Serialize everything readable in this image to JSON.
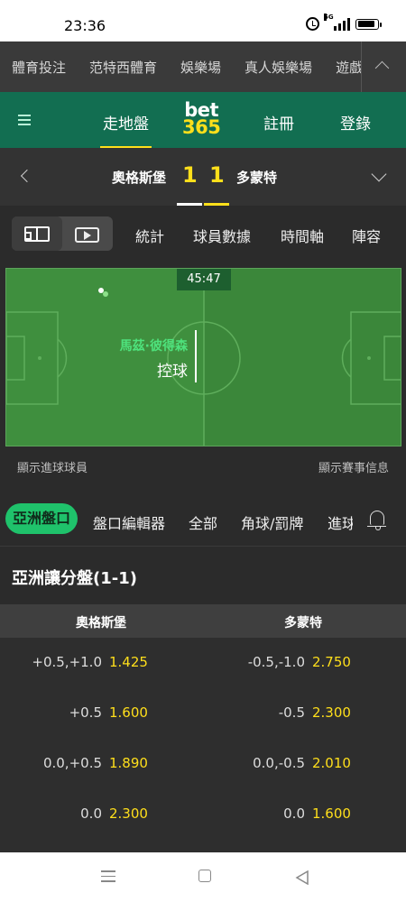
{
  "status_bar": {
    "time": "23:36",
    "signal_label": "5G",
    "battery_pct": 0.9
  },
  "top_nav": {
    "items": [
      "體育投注",
      "范特西體育",
      "娛樂場",
      "真人娛樂場",
      "遊戲"
    ]
  },
  "header": {
    "in_play": "走地盤",
    "logo_top": "bet",
    "logo_bottom": "365",
    "register": "註冊",
    "login": "登錄"
  },
  "match": {
    "home_team": "奧格斯堡",
    "away_team": "多蒙特",
    "home_score": "1",
    "away_score": "1",
    "home_color": "#ffffff",
    "away_color": "#ffdf1b"
  },
  "view_tabs": [
    "統計",
    "球員數據",
    "時間軸",
    "陣容"
  ],
  "pitch": {
    "clock": "45:47",
    "player": "馬茲·彼得森",
    "status": "控球",
    "show_scorers": "顯示進球球員",
    "show_match_info": "顯示賽事信息"
  },
  "market_tabs": {
    "active": "亞洲盤口",
    "items": [
      "盤口編輯器",
      "全部",
      "角球/罰牌"
    ],
    "clipped": "進球"
  },
  "section": {
    "title": "亞洲讓分盤(1-1)",
    "home_header": "奧格斯堡",
    "away_header": "多蒙特",
    "rows": [
      {
        "home_hcp": "+0.5,+1.0",
        "home_price": "1.425",
        "away_hcp": "-0.5,-1.0",
        "away_price": "2.750"
      },
      {
        "home_hcp": "+0.5",
        "home_price": "1.600",
        "away_hcp": "-0.5",
        "away_price": "2.300"
      },
      {
        "home_hcp": "0.0,+0.5",
        "home_price": "1.890",
        "away_hcp": "0.0,-0.5",
        "away_price": "2.010"
      },
      {
        "home_hcp": "0.0",
        "home_price": "2.300",
        "away_hcp": "0.0",
        "away_price": "1.600"
      }
    ]
  },
  "colors": {
    "brand_green": "#126e51",
    "accent_yellow": "#ffdf1b",
    "active_green": "#1fc26b",
    "pitch_green": "#3b8a3a"
  }
}
